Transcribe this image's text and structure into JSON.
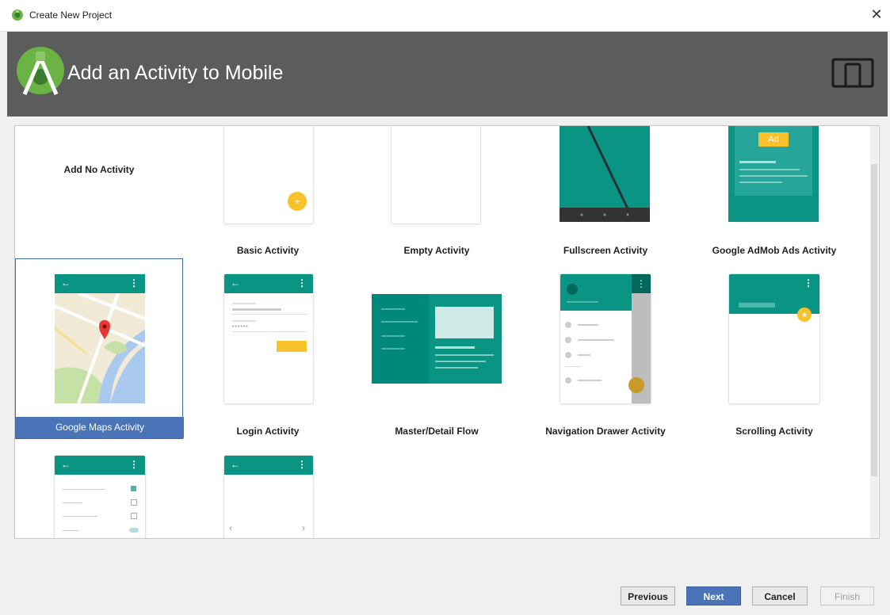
{
  "window": {
    "title": "Create New Project"
  },
  "header": {
    "title": "Add an Activity to Mobile"
  },
  "tiles": [
    {
      "label": "Add No Activity"
    },
    {
      "label": "Basic Activity"
    },
    {
      "label": "Empty Activity"
    },
    {
      "label": "Fullscreen Activity"
    },
    {
      "label": "Google AdMob Ads Activity",
      "ad_badge": "Ad"
    },
    {
      "label": "Google Maps Activity",
      "selected": true
    },
    {
      "label": "Login Activity"
    },
    {
      "label": "Master/Detail Flow"
    },
    {
      "label": "Navigation Drawer Activity"
    },
    {
      "label": "Scrolling Activity"
    },
    {
      "label": ""
    },
    {
      "label": ""
    }
  ],
  "buttons": {
    "previous": "Previous",
    "next": "Next",
    "cancel": "Cancel",
    "finish": "Finish"
  },
  "colors": {
    "teal": "#0a9484",
    "accent": "#f7c22b",
    "selection": "#4a73b8",
    "header_bg": "#5b5c5c"
  },
  "icons": {
    "app": "android-studio-icon",
    "close": "close-icon",
    "device": "phone-tablet-icon"
  }
}
